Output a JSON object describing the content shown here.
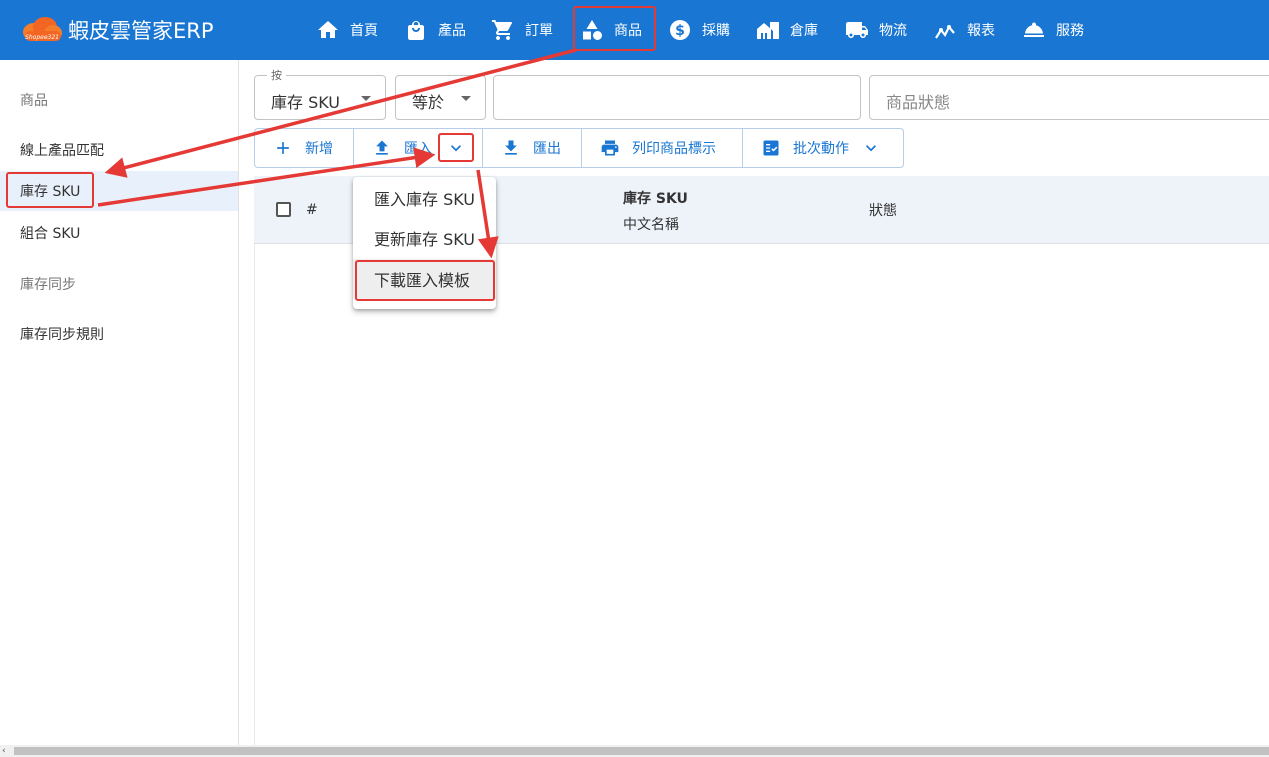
{
  "app": {
    "title": "蝦皮雲管家ERP",
    "logo_text": "Shopee321"
  },
  "nav": [
    {
      "label": "首頁",
      "icon": "home-icon"
    },
    {
      "label": "產品",
      "icon": "bag-icon"
    },
    {
      "label": "訂單",
      "icon": "cart-icon"
    },
    {
      "label": "商品",
      "icon": "shapes-icon"
    },
    {
      "label": "採購",
      "icon": "dollar-icon"
    },
    {
      "label": "倉庫",
      "icon": "warehouse-icon"
    },
    {
      "label": "物流",
      "icon": "truck-icon"
    },
    {
      "label": "報表",
      "icon": "chart-icon"
    },
    {
      "label": "服務",
      "icon": "service-bell-icon"
    }
  ],
  "sidebar": {
    "items": [
      {
        "label": "商品"
      },
      {
        "label": "線上產品匹配"
      },
      {
        "label": "庫存 SKU"
      },
      {
        "label": "組合 SKU"
      },
      {
        "label": "庫存同步"
      },
      {
        "label": "庫存同步規則"
      }
    ]
  },
  "filters": {
    "field_label": "按",
    "field_value": "庫存 SKU",
    "operator_value": "等於",
    "search_value": "",
    "status_placeholder": "商品狀態"
  },
  "toolbar": {
    "add_label": "新增",
    "import_label": "匯入",
    "export_label": "匯出",
    "print_label": "列印商品標示",
    "batch_label": "批次動作"
  },
  "table": {
    "headers": {
      "index": "#",
      "sku": "庫存 SKU",
      "cn_name": "中文名稱",
      "status": "狀態"
    }
  },
  "import_menu": {
    "items": [
      {
        "label": "匯入庫存 SKU"
      },
      {
        "label": "更新庫存 SKU"
      },
      {
        "label": "下載匯入模板"
      }
    ]
  },
  "colors": {
    "primary": "#1976d2",
    "highlight": "#e53935",
    "active_bg": "#e8f0fb"
  }
}
